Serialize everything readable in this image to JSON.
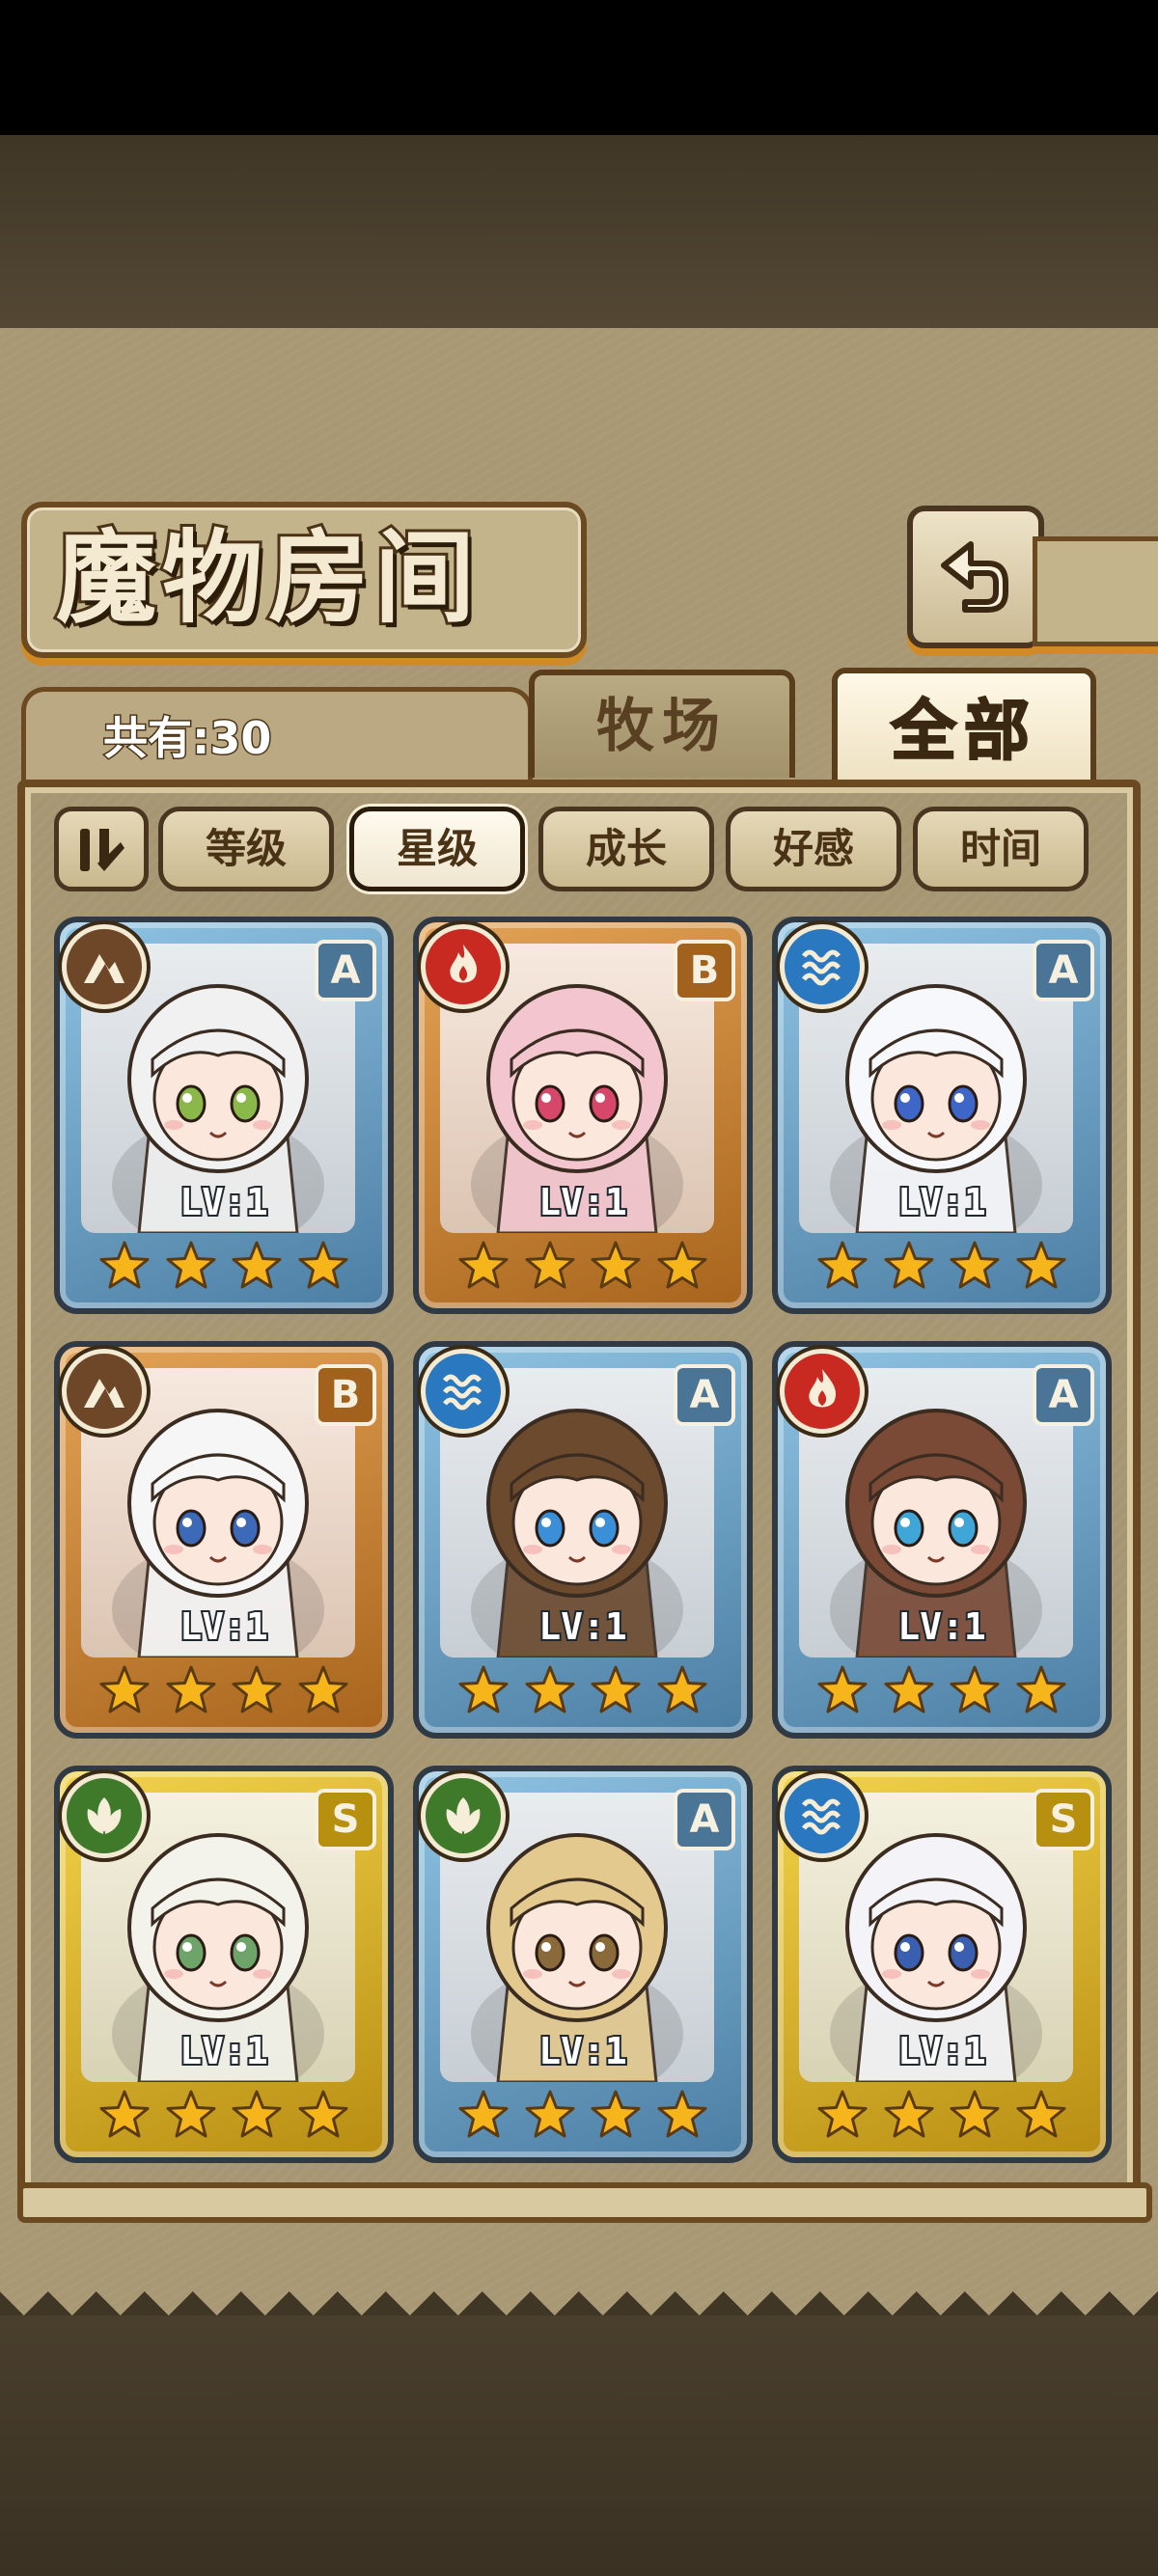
{
  "title": "魔物房间",
  "owned_count": "共有:30",
  "tabs": [
    {
      "label": "牧场",
      "active": false
    },
    {
      "label": "全部",
      "active": true
    }
  ],
  "icons": {
    "back": "back-arrow-icon",
    "sort_toggle": "sort-order-icon"
  },
  "sort_buttons": [
    {
      "label": "等级",
      "active": false
    },
    {
      "label": "星级",
      "active": true
    },
    {
      "label": "成长",
      "active": false
    },
    {
      "label": "好感",
      "active": false
    },
    {
      "label": "时间",
      "active": false
    }
  ],
  "monsters": [
    {
      "element": "earth",
      "rank": "A",
      "level": "LV:1",
      "stars": 4,
      "hair": "#f1f1f1",
      "eye": "#8bb84a"
    },
    {
      "element": "fire",
      "rank": "B",
      "level": "LV:1",
      "stars": 4,
      "hair": "#f3c6cf",
      "eye": "#d6476a"
    },
    {
      "element": "water",
      "rank": "A",
      "level": "LV:1",
      "stars": 4,
      "hair": "#f7f8fb",
      "eye": "#3d66c8"
    },
    {
      "element": "earth",
      "rank": "B",
      "level": "LV:1",
      "stars": 4,
      "hair": "#f6f6f6",
      "eye": "#3d6ab8"
    },
    {
      "element": "water",
      "rank": "A",
      "level": "LV:1",
      "stars": 4,
      "hair": "#6b4a2e",
      "eye": "#3a8fd8"
    },
    {
      "element": "fire",
      "rank": "A",
      "level": "LV:1",
      "stars": 4,
      "hair": "#7a4a36",
      "eye": "#40a6d8"
    },
    {
      "element": "wind",
      "rank": "S",
      "level": "LV:1",
      "stars": 4,
      "hair": "#f3f3ec",
      "eye": "#6ea36a"
    },
    {
      "element": "wind",
      "rank": "A",
      "level": "LV:1",
      "stars": 4,
      "hair": "#e3c98e",
      "eye": "#8a6a3a"
    },
    {
      "element": "water",
      "rank": "S",
      "level": "LV:1",
      "stars": 4,
      "hair": "#f4f4f8",
      "eye": "#3a5fb0"
    }
  ],
  "colors": {
    "rank_S": "#f2d34a",
    "rank_A": "#8fc3e2",
    "rank_B": "#e3a356",
    "star": "#f7b51c",
    "accent": "#d08a26"
  }
}
